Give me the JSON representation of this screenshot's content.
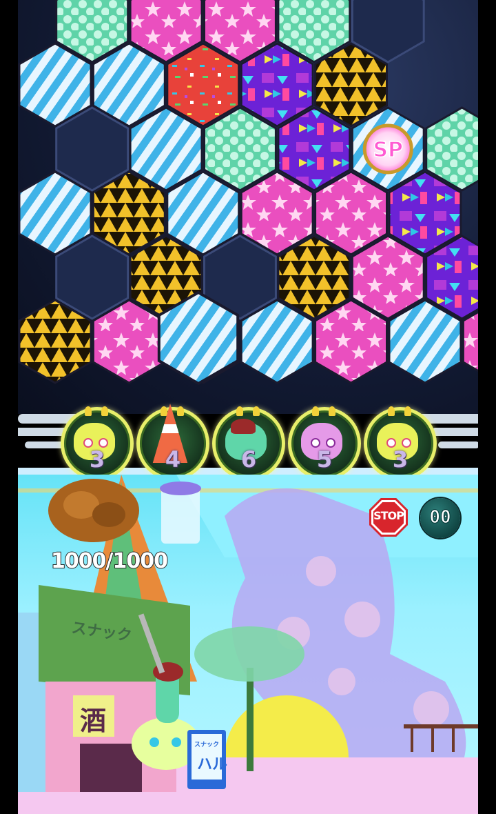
{
  "board": {
    "sp_label": "SP"
  },
  "units": [
    {
      "name": "green-sprout-monster",
      "cooldown": "3",
      "color": "#e9f15a"
    },
    {
      "name": "traffic-cone-monster",
      "cooldown": "4",
      "color": "#f07a55"
    },
    {
      "name": "helmet-batter-monster",
      "cooldown": "6",
      "color": "#5fd6a9"
    },
    {
      "name": "pink-blob-monster",
      "cooldown": "5",
      "color": "#e59ae8"
    },
    {
      "name": "green-sprout-monster",
      "cooldown": "3",
      "color": "#e9f15a"
    }
  ],
  "enemy": {
    "hp": "1000/1000"
  },
  "controls": {
    "stop_label": "STOP",
    "counter": "00"
  },
  "scene": {
    "shop_sign": "スナック",
    "sake_sign": "酒",
    "snack_board_top": "スナック",
    "snack_board_name": "ハル"
  },
  "colors": {
    "stripe_tile": "#46b8ea",
    "dot_tile": "#8fe8c4",
    "star_tile": "#ea55c0",
    "triangle_tile": "#e8b620",
    "cube_tile": "#7a2de0",
    "confetti_tile": "#e8423a"
  }
}
